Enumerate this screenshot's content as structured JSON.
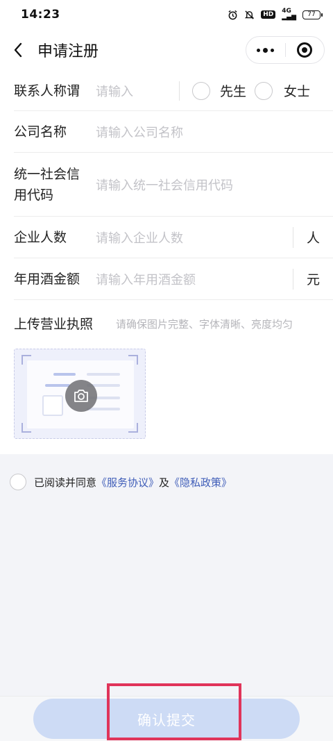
{
  "status_bar": {
    "time": "14:23",
    "network": "4G",
    "hd": "HD",
    "battery": "77"
  },
  "nav": {
    "title": "申请注册"
  },
  "form": {
    "contact": {
      "label": "联系人称谓",
      "placeholder": "请输入",
      "option_mr": "先生",
      "option_ms": "女士"
    },
    "company": {
      "label": "公司名称",
      "placeholder": "请输入公司名称"
    },
    "credit_code": {
      "label_line1": "统一社会信",
      "label_line2": "用代码",
      "placeholder": "请输入统一社会信用代码"
    },
    "employees": {
      "label": "企业人数",
      "placeholder": "请输入企业人数",
      "unit": "人"
    },
    "annual_amount": {
      "label": "年用酒金额",
      "placeholder": "请输入年用酒金额",
      "unit": "元"
    },
    "upload": {
      "label": "上传营业执照",
      "hint": "请确保图片完整、字体清晰、亮度均匀"
    }
  },
  "agreement": {
    "prefix": "已阅读并同意",
    "service_link": "《服务协议》",
    "and": "及",
    "privacy_link": "《隐私政策》"
  },
  "submit": {
    "label": "确认提交"
  },
  "colors": {
    "link": "#3f5db8",
    "submit_bg": "#cddbf5",
    "highlight": "#e0345a"
  }
}
